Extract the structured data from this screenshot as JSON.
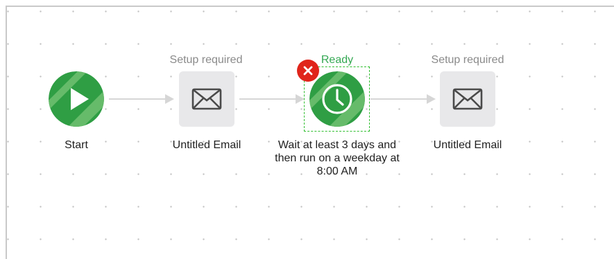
{
  "canvas": {
    "accent_color": "#34a853",
    "status_ready_color": "#34a853",
    "status_required_color": "#8a8a8a",
    "delete_color": "#e0251b"
  },
  "nodes": [
    {
      "id": "start",
      "type": "start",
      "status": "",
      "label": "Start",
      "icon": "play-icon"
    },
    {
      "id": "email-1",
      "type": "email",
      "status": "Setup required",
      "label": "Untitled Email",
      "icon": "envelope-icon"
    },
    {
      "id": "wait",
      "type": "wait",
      "status": "Ready",
      "label": "Wait at least 3 days and then run on a weekday at 8:00 AM",
      "icon": "clock-icon",
      "selected": true
    },
    {
      "id": "email-2",
      "type": "email",
      "status": "Setup required",
      "label": "Untitled Email",
      "icon": "envelope-icon"
    }
  ],
  "delete_badge": {
    "icon": "close-icon"
  }
}
